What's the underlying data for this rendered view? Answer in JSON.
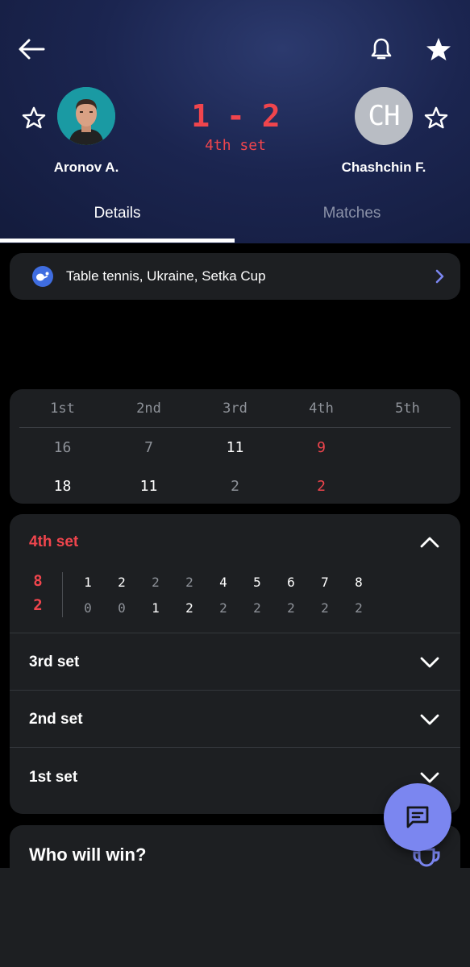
{
  "header": {
    "player_left": {
      "name": "Aronov A."
    },
    "player_right": {
      "name": "Chashchin F.",
      "initials": "CH"
    },
    "score": "1 - 2",
    "current_set": "4th set"
  },
  "tabs": [
    {
      "label": "Details",
      "active": true
    },
    {
      "label": "Matches",
      "active": false
    }
  ],
  "league": {
    "label": "Table tennis, Ukraine, Setka Cup"
  },
  "score_table": {
    "headers": [
      "1st",
      "2nd",
      "3rd",
      "4th",
      "5th"
    ],
    "rows": [
      [
        "16",
        "7",
        "11",
        "9",
        ""
      ],
      [
        "18",
        "11",
        "2",
        "2",
        ""
      ]
    ]
  },
  "sets": {
    "expanded": {
      "title": "4th set",
      "total_top": "8",
      "total_bottom": "2",
      "progress_top": [
        "1",
        "2",
        "2",
        "2",
        "4",
        "5",
        "6",
        "7",
        "8"
      ],
      "progress_bottom": [
        "0",
        "0",
        "1",
        "2",
        "2",
        "2",
        "2",
        "2",
        "2"
      ]
    },
    "collapsed": [
      "3rd set",
      "2nd set",
      "1st set"
    ]
  },
  "prediction": {
    "title": "Who will win?"
  },
  "colors": {
    "accent_red": "#f0454d",
    "fab": "#7b86f0",
    "header_bg": "#1b2550",
    "card_bg": "#1d1f22"
  },
  "icons": [
    "back-arrow-icon",
    "bell-icon",
    "star-filled-icon",
    "star-outline-icon",
    "table-tennis-icon",
    "chevron-right-icon",
    "chevron-up-icon",
    "chevron-down-icon",
    "chat-icon",
    "trophy-icon"
  ]
}
